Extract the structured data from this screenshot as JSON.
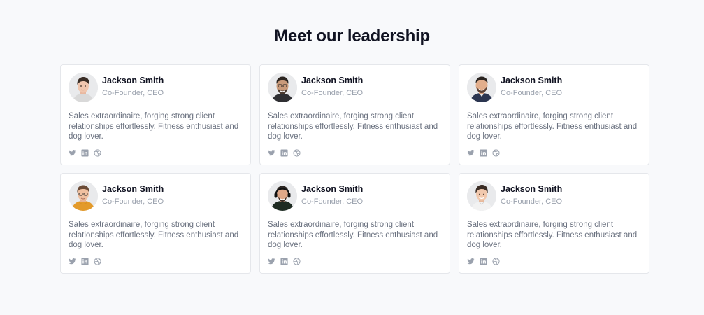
{
  "section": {
    "title": "Meet our leadership"
  },
  "members": [
    {
      "name": "Jackson Smith",
      "role": "Co-Founder, CEO",
      "bio": "Sales extraordinaire, forging strong client relationships effortlessly. Fitness enthusiast and dog lover.",
      "socials": [
        "twitter-icon",
        "linkedin-icon",
        "dribbble-icon"
      ]
    },
    {
      "name": "Jackson Smith",
      "role": "Co-Founder, CEO",
      "bio": "Sales extraordinaire, forging strong client relationships effortlessly. Fitness enthusiast and dog lover.",
      "socials": [
        "twitter-icon",
        "linkedin-icon",
        "dribbble-icon"
      ]
    },
    {
      "name": "Jackson Smith",
      "role": "Co-Founder, CEO",
      "bio": "Sales extraordinaire, forging strong client relationships effortlessly. Fitness enthusiast and dog lover.",
      "socials": [
        "twitter-icon",
        "linkedin-icon",
        "dribbble-icon"
      ]
    },
    {
      "name": "Jackson Smith",
      "role": "Co-Founder, CEO",
      "bio": "Sales extraordinaire, forging strong client relationships effortlessly. Fitness enthusiast and dog lover.",
      "socials": [
        "twitter-icon",
        "linkedin-icon",
        "dribbble-icon"
      ]
    },
    {
      "name": "Jackson Smith",
      "role": "Co-Founder, CEO",
      "bio": "Sales extraordinaire, forging strong client relationships effortlessly. Fitness enthusiast and dog lover.",
      "socials": [
        "twitter-icon",
        "linkedin-icon",
        "dribbble-icon"
      ]
    },
    {
      "name": "Jackson Smith",
      "role": "Co-Founder, CEO",
      "bio": "Sales extraordinaire, forging strong client relationships effortlessly. Fitness enthusiast and dog lover.",
      "socials": [
        "twitter-icon",
        "linkedin-icon",
        "dribbble-icon"
      ]
    }
  ],
  "colors": {
    "background": "#f8f9fb",
    "card": "#ffffff",
    "border": "#e5e7eb",
    "heading": "#111322",
    "muted": "#9aa1ad",
    "body_text": "#6b7280",
    "icon": "#9aa1ad"
  }
}
